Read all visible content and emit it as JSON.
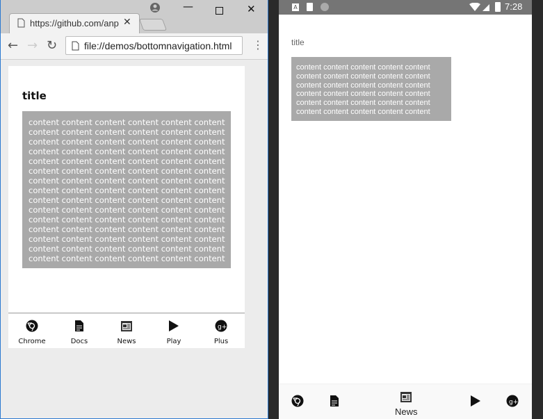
{
  "browser": {
    "tab_title": "https://github.com/anp",
    "url": "file://demos/bottomnavigation.html",
    "accent": "#2b79d0"
  },
  "desktop_page": {
    "title": "title",
    "content_lines": [
      "content content content content content content",
      "content content content content content content",
      "content content content content content content",
      "content content content content content content",
      "content content content content content content",
      "content content content content content content",
      "content content content content content content",
      "content content content content content content",
      "content content content content content content",
      "content content content content content content",
      "content content content content content content",
      "content content content content content content",
      "content content content content content content",
      "content content content content content content",
      "content content content content content content"
    ],
    "nav": [
      {
        "label": "Chrome",
        "icon": "chrome-icon"
      },
      {
        "label": "Docs",
        "icon": "docs-icon"
      },
      {
        "label": "News",
        "icon": "news-icon"
      },
      {
        "label": "Play",
        "icon": "play-icon"
      },
      {
        "label": "Plus",
        "icon": "google-plus-icon"
      }
    ]
  },
  "phone": {
    "time": "7:28",
    "title": "title",
    "content_lines": [
      "content content content content content",
      "content content content content content",
      "content content content content content",
      "content content content content content",
      "content content content content content",
      "content content content content content"
    ],
    "nav_active_label": "News"
  }
}
